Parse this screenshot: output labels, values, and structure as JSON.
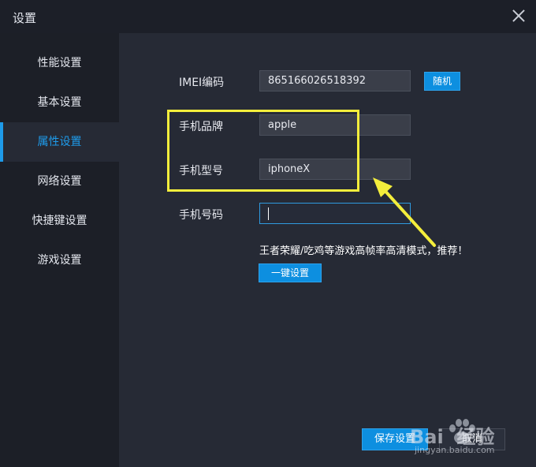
{
  "window": {
    "title": "设置"
  },
  "sidebar": {
    "items": [
      {
        "label": "性能设置"
      },
      {
        "label": "基本设置"
      },
      {
        "label": "属性设置"
      },
      {
        "label": "网络设置"
      },
      {
        "label": "快捷键设置"
      },
      {
        "label": "游戏设置"
      }
    ],
    "active_index": 2
  },
  "form": {
    "imei_label": "IMEI编码",
    "imei_value": "865166026518392",
    "random_button": "随机",
    "brand_label": "手机品牌",
    "brand_value": "apple",
    "model_label": "手机型号",
    "model_value": "iphoneX",
    "phone_label": "手机号码",
    "phone_value": "",
    "hint": "王者荣耀/吃鸡等游戏高帧率高清模式，推荐！",
    "one_key_button": "一键设置"
  },
  "footer": {
    "save_button": "保存设置",
    "cancel_button": "取消"
  },
  "watermark": {
    "brand": "Bai  经验",
    "url": "jingyan.baidu.com"
  },
  "colors": {
    "accent": "#1e9bea",
    "highlight": "#f4ee3c",
    "sidebar_bg": "#1c1f27",
    "content_bg": "#262a35"
  }
}
